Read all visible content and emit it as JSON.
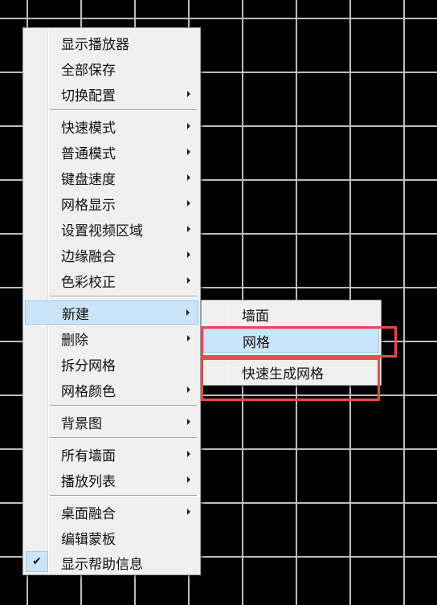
{
  "context_menu": {
    "groups": [
      [
        "显示播放器",
        "全部保存",
        "切换配置"
      ],
      [
        "快速模式",
        "普通模式",
        "键盘速度",
        "网格显示",
        "设置视频区域",
        "边缘融合",
        "色彩校正"
      ],
      [
        "新建",
        "删除",
        "拆分网格",
        "网格颜色"
      ],
      [
        "背景图"
      ],
      [
        "所有墙面",
        "播放列表"
      ],
      [
        "桌面融合",
        "编辑蒙板",
        "显示帮助信息"
      ]
    ],
    "check_mark": "✔"
  },
  "submenu_new": {
    "items": [
      "墙面",
      "网格",
      "快速生成网格"
    ]
  },
  "colors": {
    "highlight": "#cce4f7",
    "highlight_border": "#99c9ef",
    "annotation_red": "#e94a4a"
  }
}
